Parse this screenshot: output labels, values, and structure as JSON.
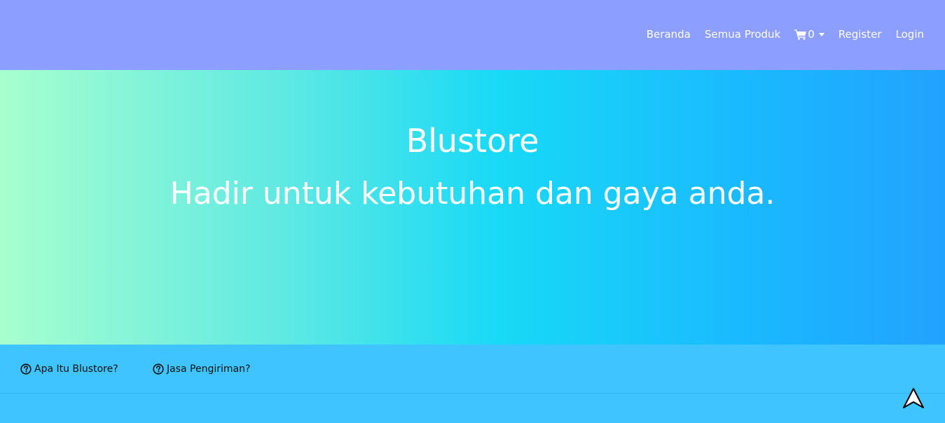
{
  "nav": {
    "items": [
      {
        "label": "Beranda"
      },
      {
        "label": "Semua Produk"
      },
      {
        "label": "Register"
      },
      {
        "label": "Login"
      }
    ],
    "cart": {
      "count": "0",
      "icon": "cart-icon"
    }
  },
  "hero": {
    "title": "Blustore",
    "subtitle": "Hadir untuk kebutuhan dan gaya anda."
  },
  "info": {
    "links": [
      {
        "label": "Apa Itu Blustore?",
        "icon": "question-circle-icon"
      },
      {
        "label": "Jasa Pengiriman?",
        "icon": "question-circle-icon"
      }
    ]
  },
  "colors": {
    "navbar": "#8c9eff",
    "hero_start": "#a7ffcf",
    "hero_mid": "#18d9f6",
    "hero_end": "#22a2ff",
    "info_bar": "#40c4ff"
  }
}
